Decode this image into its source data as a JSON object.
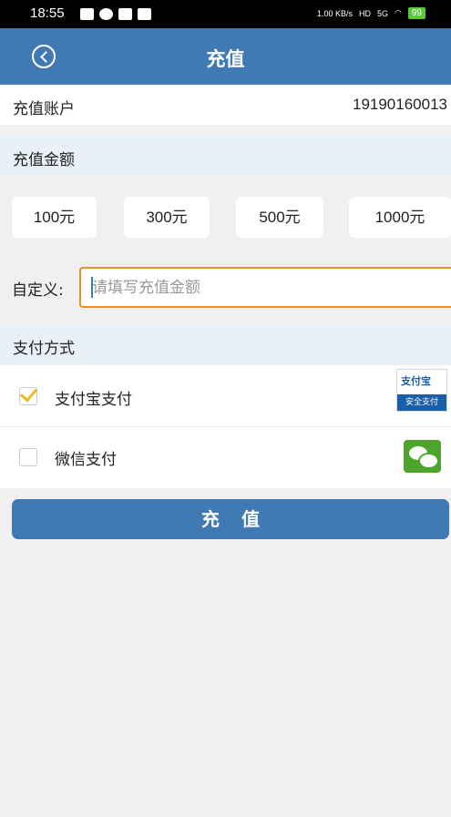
{
  "status_bar": {
    "time": "18:55",
    "net_speed": "1.00 KB/s",
    "hd": "HD",
    "signal": "5G",
    "battery": "99"
  },
  "header": {
    "title": "充值",
    "back_icon": "chevron-left-circle-icon",
    "bg_color": "#3f7ab5"
  },
  "account": {
    "label": "充值账户",
    "value": "19190160013"
  },
  "amount_section": {
    "title": "充值金额",
    "options": [
      "100元",
      "300元",
      "500元",
      "1000元"
    ]
  },
  "custom": {
    "label": "自定义:",
    "placeholder": "请填写充值金额",
    "value": ""
  },
  "payment_section": {
    "title": "支付方式",
    "methods": [
      {
        "label": "支付宝支付",
        "checked": true,
        "icon": "alipay-icon",
        "logo_top": "支付宝",
        "logo_bottom": "安全支付"
      },
      {
        "label": "微信支付",
        "checked": false,
        "icon": "wechat-icon"
      }
    ]
  },
  "submit": {
    "label": "充值"
  },
  "colors": {
    "accent": "#3f7ab5",
    "input_border": "#e8912a",
    "check": "#f2b81f",
    "section_bg": "#e9f0fa"
  }
}
